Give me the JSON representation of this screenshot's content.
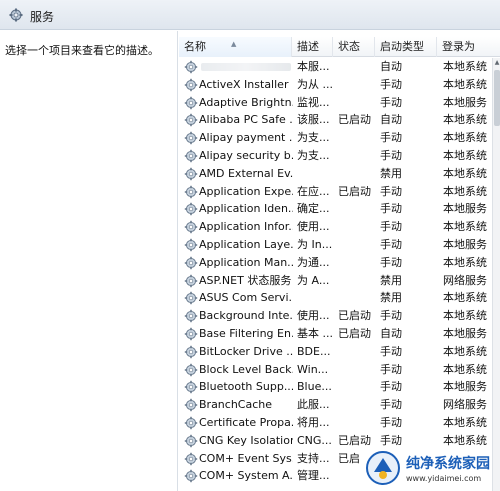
{
  "window": {
    "title": "服务"
  },
  "left_pane": {
    "description": "选择一个项目来查看它的描述。"
  },
  "columns": {
    "name": "名称",
    "description": "描述",
    "status": "状态",
    "startup": "启动类型",
    "logon": "登录为"
  },
  "services": [
    {
      "name": "",
      "desc": "本服...",
      "status": "",
      "startup": "自动",
      "logon": "本地系统"
    },
    {
      "name": "ActiveX Installer ...",
      "desc": "为从 ...",
      "status": "",
      "startup": "手动",
      "logon": "本地系统"
    },
    {
      "name": "Adaptive Brightn...",
      "desc": "监视...",
      "status": "",
      "startup": "手动",
      "logon": "本地服务"
    },
    {
      "name": "Alibaba PC Safe ...",
      "desc": "该服...",
      "status": "已启动",
      "startup": "自动",
      "logon": "本地系统"
    },
    {
      "name": "Alipay payment ...",
      "desc": "为支...",
      "status": "",
      "startup": "手动",
      "logon": "本地系统"
    },
    {
      "name": "Alipay security b...",
      "desc": "为支...",
      "status": "",
      "startup": "手动",
      "logon": "本地系统"
    },
    {
      "name": "AMD External Ev...",
      "desc": "",
      "status": "",
      "startup": "禁用",
      "logon": "本地系统"
    },
    {
      "name": "Application Expe...",
      "desc": "在应...",
      "status": "已启动",
      "startup": "手动",
      "logon": "本地系统"
    },
    {
      "name": "Application Iden...",
      "desc": "确定...",
      "status": "",
      "startup": "手动",
      "logon": "本地服务"
    },
    {
      "name": "Application Infor...",
      "desc": "使用...",
      "status": "",
      "startup": "手动",
      "logon": "本地系统"
    },
    {
      "name": "Application Laye...",
      "desc": "为 In...",
      "status": "",
      "startup": "手动",
      "logon": "本地服务"
    },
    {
      "name": "Application Man...",
      "desc": "为通...",
      "status": "",
      "startup": "手动",
      "logon": "本地系统"
    },
    {
      "name": "ASP.NET 状态服务",
      "desc": "为 A...",
      "status": "",
      "startup": "禁用",
      "logon": "网络服务"
    },
    {
      "name": "ASUS Com Servi...",
      "desc": "",
      "status": "",
      "startup": "禁用",
      "logon": "本地系统"
    },
    {
      "name": "Background Inte...",
      "desc": "使用...",
      "status": "已启动",
      "startup": "手动",
      "logon": "本地系统"
    },
    {
      "name": "Base Filtering En...",
      "desc": "基本 ...",
      "status": "已启动",
      "startup": "自动",
      "logon": "本地服务"
    },
    {
      "name": "BitLocker Drive ...",
      "desc": "BDE...",
      "status": "",
      "startup": "手动",
      "logon": "本地系统"
    },
    {
      "name": "Block Level Back...",
      "desc": "Win...",
      "status": "",
      "startup": "手动",
      "logon": "本地系统"
    },
    {
      "name": "Bluetooth Supp...",
      "desc": "Blue...",
      "status": "",
      "startup": "手动",
      "logon": "本地服务"
    },
    {
      "name": "BranchCache",
      "desc": "此服...",
      "status": "",
      "startup": "手动",
      "logon": "网络服务"
    },
    {
      "name": "Certificate Propa...",
      "desc": "将用...",
      "status": "",
      "startup": "手动",
      "logon": "本地系统"
    },
    {
      "name": "CNG Key Isolation",
      "desc": "CNG...",
      "status": "已启动",
      "startup": "手动",
      "logon": "本地系统"
    },
    {
      "name": "COM+ Event Sys...",
      "desc": "支持...",
      "status": "已启",
      "startup": "",
      "logon": ""
    },
    {
      "name": "COM+ System A...",
      "desc": "管理...",
      "status": "",
      "startup": "",
      "logon": ""
    }
  ],
  "icons": {
    "title": "services-gear-icon",
    "row": "service-gear-icon"
  },
  "watermark": {
    "name": "纯净系统家园",
    "url": "www.yidaimei.com"
  },
  "colors": {
    "title_bar": "#dfe6ee",
    "header": "#f1f4f7",
    "watermark_blue": "#1c5fb8"
  }
}
